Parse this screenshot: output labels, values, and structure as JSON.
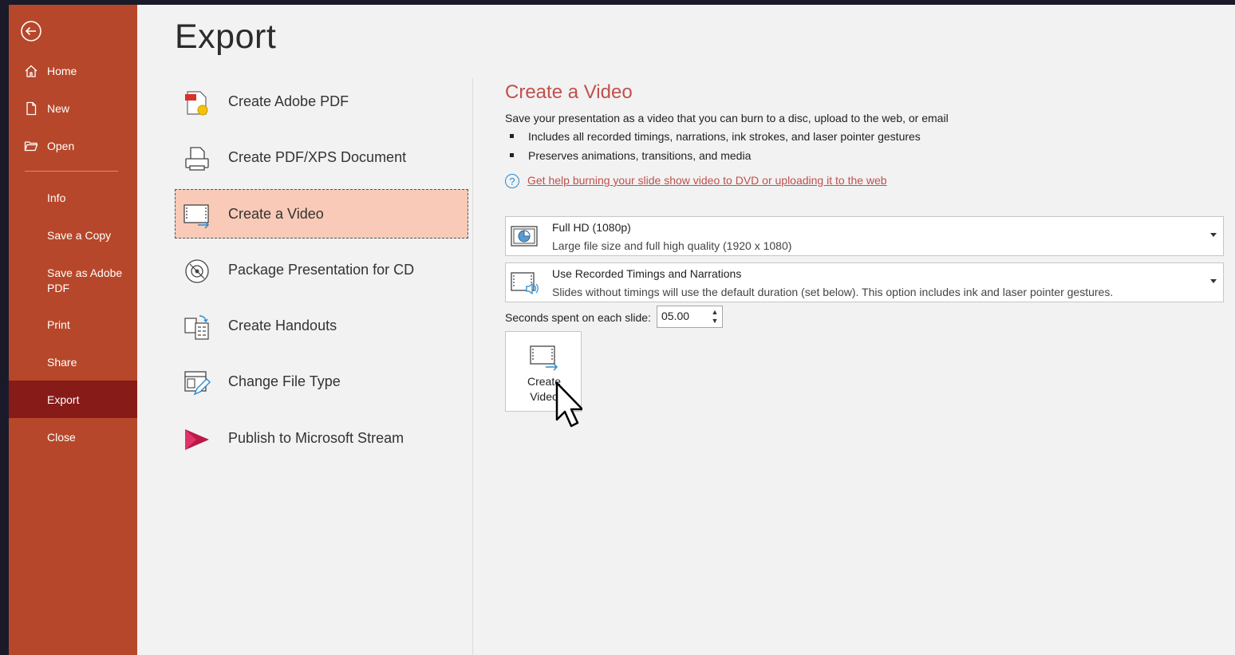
{
  "sidebar": {
    "back_icon": "back-arrow-circle-icon",
    "items": [
      {
        "label": "Home",
        "icon": "home-icon"
      },
      {
        "label": "New",
        "icon": "new-document-icon"
      },
      {
        "label": "Open",
        "icon": "open-folder-icon"
      },
      {
        "label": "Info"
      },
      {
        "label": "Save a Copy"
      },
      {
        "label": "Save as Adobe PDF"
      },
      {
        "label": "Print"
      },
      {
        "label": "Share"
      },
      {
        "label": "Export",
        "active": true
      },
      {
        "label": "Close"
      }
    ]
  },
  "page_title": "Export",
  "options": [
    {
      "label": "Create Adobe PDF",
      "icon": "adobe-pdf-icon"
    },
    {
      "label": "Create PDF/XPS Document",
      "icon": "pdf-xps-document-icon"
    },
    {
      "label": "Create a Video",
      "icon": "video-export-icon",
      "selected": true
    },
    {
      "label": "Package Presentation for CD",
      "icon": "cd-package-icon"
    },
    {
      "label": "Create Handouts",
      "icon": "handouts-icon"
    },
    {
      "label": "Change File Type",
      "icon": "change-file-type-icon"
    },
    {
      "label": "Publish to Microsoft Stream",
      "icon": "microsoft-stream-icon"
    }
  ],
  "detail": {
    "title": "Create a Video",
    "description": "Save your presentation as a video that you can burn to a disc, upload to the web, or email",
    "bullets": [
      "Includes all recorded timings, narrations, ink strokes, and laser pointer gestures",
      "Preserves animations, transitions, and media"
    ],
    "help_link": "Get help burning your slide show video to DVD or uploading it to the web",
    "quality": {
      "title": "Full HD (1080p)",
      "subtitle": "Large file size and full high quality (1920 x 1080)"
    },
    "timings": {
      "title": "Use Recorded Timings and Narrations",
      "subtitle": "Slides without timings will use the default duration (set below). This option includes ink and laser pointer gestures."
    },
    "seconds_label": "Seconds spent on each slide:",
    "seconds_value": "05.00",
    "create_button_line1": "Create",
    "create_button_line2": "Video"
  },
  "colors": {
    "sidebar_bg": "#b7472a",
    "sidebar_active": "#861b18",
    "selected_option_bg": "#f9cab7",
    "accent_text": "#c0504d",
    "help_icon": "#2b8ad1"
  }
}
